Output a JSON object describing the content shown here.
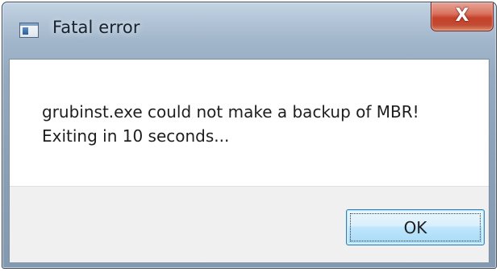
{
  "window": {
    "title": "Fatal error",
    "icon": "application-window-icon",
    "close_glyph": "X"
  },
  "message": {
    "lines": [
      "grubinst.exe could not make a backup of MBR!",
      "Exiting in 10 seconds..."
    ]
  },
  "buttons": {
    "ok_label": "OK"
  },
  "colors": {
    "close_button": "#c6412a",
    "ok_button_border": "#3c7fb1",
    "frame": "#9fb3c8"
  }
}
